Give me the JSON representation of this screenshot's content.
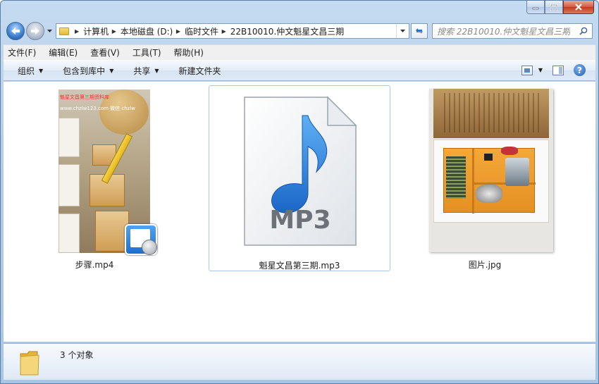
{
  "window": {
    "controls": {
      "minimize_icon": "minimize-icon",
      "maximize_icon": "maximize-icon",
      "close_icon": "close-icon"
    }
  },
  "address": {
    "crumbs": [
      "计算机",
      "本地磁盘 (D:)",
      "临时文件",
      "22B10010.仲文魁星文昌三期"
    ],
    "search_placeholder": "搜索 22B10010.仲文魁星文昌三期"
  },
  "menu": {
    "items": [
      "文件(F)",
      "编辑(E)",
      "查看(V)",
      "工具(T)",
      "帮助(H)"
    ]
  },
  "commands": {
    "organize": "组织",
    "include_library": "包含到库中",
    "share": "共享",
    "new_folder": "新建文件夹"
  },
  "files": [
    {
      "name": "步骤.mp4",
      "type": "video",
      "icon": "video-file-icon",
      "watermark_top": "魁星文昌第三期资料库",
      "watermark_bottom": "www.chzlw123.com 微信 chzlw"
    },
    {
      "name": "魁星文昌第三期.mp3",
      "type": "audio",
      "icon": "mp3-file-icon",
      "badge_text": "MP3",
      "selected": true
    },
    {
      "name": "图片.jpg",
      "type": "image",
      "icon": "image-file-icon"
    }
  ],
  "status": {
    "count_text": "3 个对象"
  },
  "colors": {
    "accent": "#2a7ad5",
    "selection_border": "#aac8e6",
    "mp3_note": "#2e86de"
  }
}
